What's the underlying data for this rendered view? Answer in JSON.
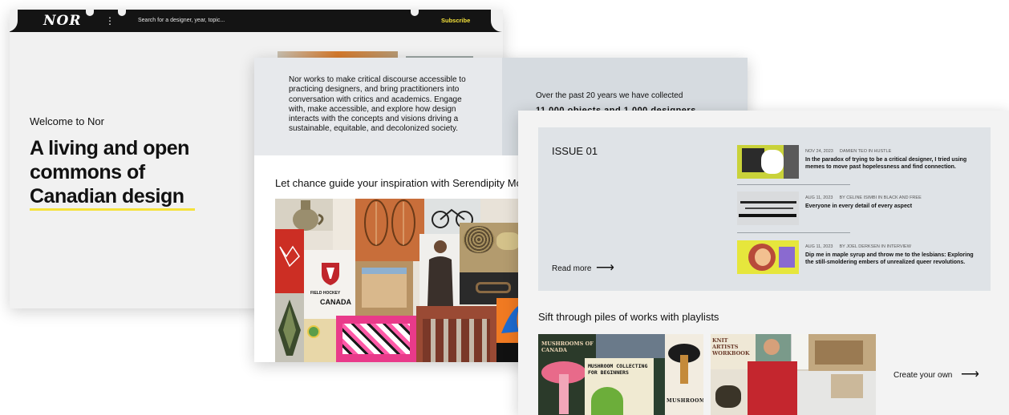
{
  "site": {
    "logo": "NOR",
    "menu_dots": "⋮",
    "search_placeholder": "Search for a designer, year, topic...",
    "subscribe": "Subscribe"
  },
  "hero": {
    "welcome": "Welcome to Nor",
    "headline_line1": "A living and open",
    "headline_line2": "commons of",
    "headline_line3": "Canadian design"
  },
  "about": {
    "text": "Nor works to make critical discourse accessible to practicing designers, and bring practitioners into conversation with critics and academics. Engage with, make accessible, and explore how design interacts with the concepts and visions driving a sustainable, equitable, and decolonized society.",
    "collected": "Over the past 20 years we have collected",
    "collected_counts": "11,000 objects and 1,000 designers"
  },
  "serendipity": {
    "heading": "Let chance guide your inspiration with Serendipity Mode",
    "poster_text_1": "FIELD HOCKEY",
    "poster_text_2": "CANADA"
  },
  "issue": {
    "title": "ISSUE 01",
    "read_more": "Read more",
    "arrow": "⟶",
    "articles": [
      {
        "date": "NOV 24, 2023",
        "byline": "DAMIEN TEO IN HUSTLE",
        "title": "In the paradox of trying to be a critical designer, I tried using memes to move past hopelessness and find connection."
      },
      {
        "date": "AUG 11, 2023",
        "byline": "BY CELINE ISIMBI IN BLACK AND FREE",
        "title": "Everyone in every detail of every aspect"
      },
      {
        "date": "AUG 11, 2023",
        "byline": "BY JOEL DERKSEN IN INTERVIEW",
        "title": "Dip me in maple syrup and throw me to the lesbians: Exploring the still-smoldering embers of unrealized queer revolutions."
      }
    ]
  },
  "playlists": {
    "heading": "Sift through piles of works with playlists",
    "create_own": "Create your own",
    "arrow": "⟶",
    "poster_1": "MUSHROOMS OF CANADA",
    "poster_2": "MUSHROOM COLLECTING FOR BEGINNERS",
    "poster_3": "MUSHROOM",
    "poster_4": "KNIT ARTISTS WORKBOOK"
  },
  "colors": {
    "accent_yellow": "#f5e23a",
    "topbar": "#141414",
    "panel_grey": "#dfe3e7"
  }
}
